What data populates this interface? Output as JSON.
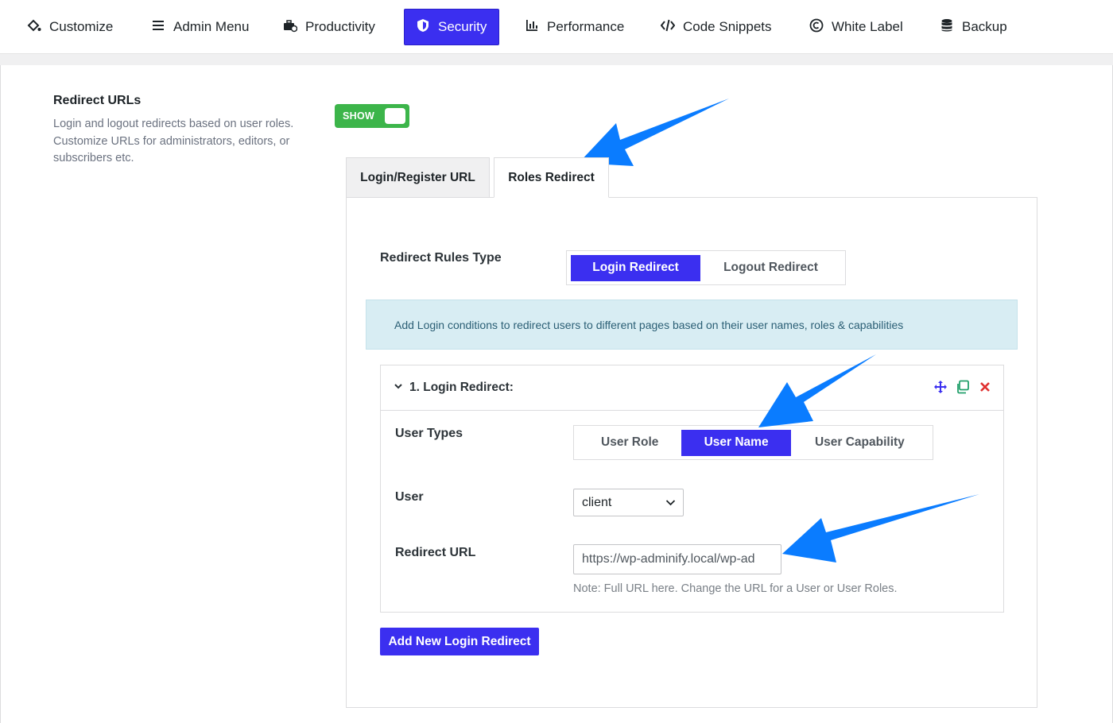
{
  "nav": {
    "items": [
      {
        "label": "Customize",
        "icon": "paint-bucket-icon"
      },
      {
        "label": "Admin Menu",
        "icon": "hamburger-menu-icon"
      },
      {
        "label": "Productivity",
        "icon": "toolbox-icon"
      },
      {
        "label": "Security",
        "icon": "shield-icon",
        "active": true
      },
      {
        "label": "Performance",
        "icon": "bar-chart-icon"
      },
      {
        "label": "Code Snippets",
        "icon": "code-icon"
      },
      {
        "label": "White Label",
        "icon": "copyright-icon"
      },
      {
        "label": "Backup",
        "icon": "database-icon"
      }
    ]
  },
  "section": {
    "title": "Redirect URLs",
    "description": "Login and logout redirects based on user roles. Customize URLs for administrators, editors, or subscribers etc.",
    "toggle_label": "SHOW"
  },
  "tabs": {
    "login_register": "Login/Register URL",
    "roles_redirect": "Roles Redirect"
  },
  "rules": {
    "label": "Redirect Rules Type",
    "login_redirect": "Login Redirect",
    "logout_redirect": "Logout Redirect"
  },
  "info": "Add Login conditions to redirect users to different pages based on their user names, roles & capabilities",
  "repeater": {
    "title": "1. Login Redirect:",
    "user_types_label": "User Types",
    "user_role": "User Role",
    "user_name": "User Name",
    "user_capability": "User Capability",
    "user_label": "User",
    "user_value": "client",
    "redirect_url_label": "Redirect URL",
    "redirect_url_value": "https://wp-adminify.local/wp-ad",
    "note": "Note: Full URL here. Change the URL for a User or User Roles."
  },
  "add_button": "Add New Login Redirect",
  "colors": {
    "accent": "#3b2ff0",
    "toggle_green": "#3cb54a",
    "info_bg": "#d8edf3",
    "arrow_blue": "#0a7cff"
  }
}
